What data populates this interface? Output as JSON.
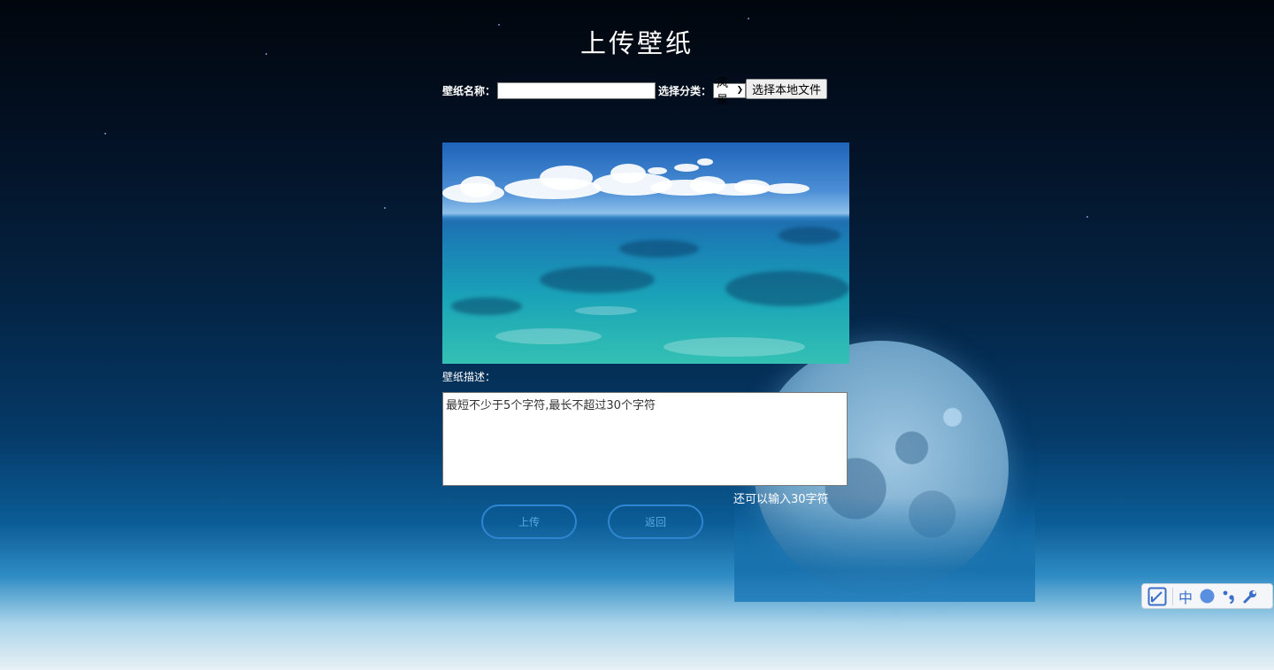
{
  "page": {
    "title": "上传壁纸"
  },
  "form": {
    "name_label": "壁纸名称：",
    "name_value": "",
    "category_label": "选择分类：",
    "category_selected": "风景",
    "file_button": "选择本地文件",
    "desc_label": "壁纸描述：",
    "desc_placeholder": "最短不少于5个字符,最长不超过30个字符",
    "remaining_text": "还可以输入30字符"
  },
  "buttons": {
    "upload": "上传",
    "back": "返回"
  },
  "ime_toolbar": {
    "mode": "中",
    "icons": [
      "settings-panel-icon",
      "ime-mode-icon",
      "moon-icon",
      "punctuation-icon",
      "wrench-icon"
    ]
  },
  "colors": {
    "button_border": "#2f86d0",
    "button_text": "#58a8e6",
    "ime_icon": "#3b6ec9"
  }
}
